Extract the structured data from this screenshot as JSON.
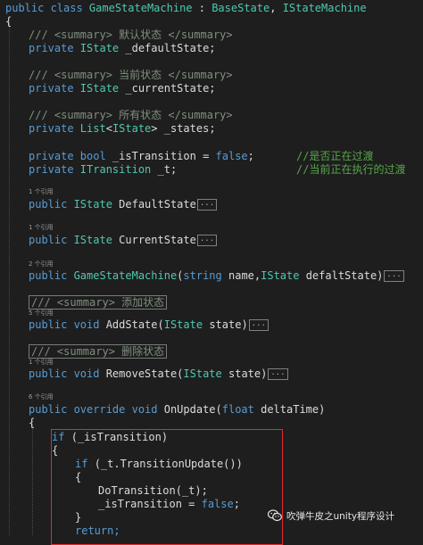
{
  "code": {
    "l1_class": "public class GameStateMachine : BaseState, IStateMachine",
    "l2_brace": "{",
    "l3_comment": "/// <summary> 默认状态 </summary>",
    "l4": "private IState _defaultState;",
    "l5_comment": "/// <summary> 当前状态 </summary>",
    "l6": "private IState _currentState;",
    "l7_comment": "/// <summary> 所有状态 </summary>",
    "l8": "private List<IState> _states;",
    "l9": "private bool _isTransition = false;",
    "l9_comment": "//是否正在过渡",
    "l10": "private ITransition _t;",
    "l10_comment": "//当前正在执行的过渡",
    "ref1": "1 个引用",
    "l11": "public IState DefaultState",
    "ref2": "1 个引用",
    "l12": "public IState CurrentState",
    "ref3": "2 个引用",
    "l13": "public GameStateMachine(string name,IState defaltState)",
    "l14_comment": "/// <summary> 添加状态",
    "ref4": "5 个引用",
    "l15": "public void AddState(IState state)",
    "l16_comment": "/// <summary> 删除状态",
    "ref5": "1 个引用",
    "l17": "public void RemoveState(IState state)",
    "ref6": "6 个引用",
    "l18": "public override void OnUpdate(float deltaTime)",
    "l19_brace": "{",
    "l20": "if (_isTransition)",
    "l21_brace": "{",
    "l22": "if (_t.TransitionUpdate())",
    "l23_brace": "{",
    "l24": "DoTransition(_t);",
    "l25": "_isTransition = false;",
    "l26_brace": "}",
    "l27": "return;",
    "fold": "..."
  },
  "watermark": {
    "text": "吹弹牛皮之unity程序设计",
    "icon": "wechat-icon"
  },
  "colors": {
    "keyword": "#569cd6",
    "type": "#4ec9b0",
    "comment": "#57a64a",
    "text": "#dcdcdc",
    "highlight_box": "#e32b2b",
    "background": "#1e1e1e"
  }
}
